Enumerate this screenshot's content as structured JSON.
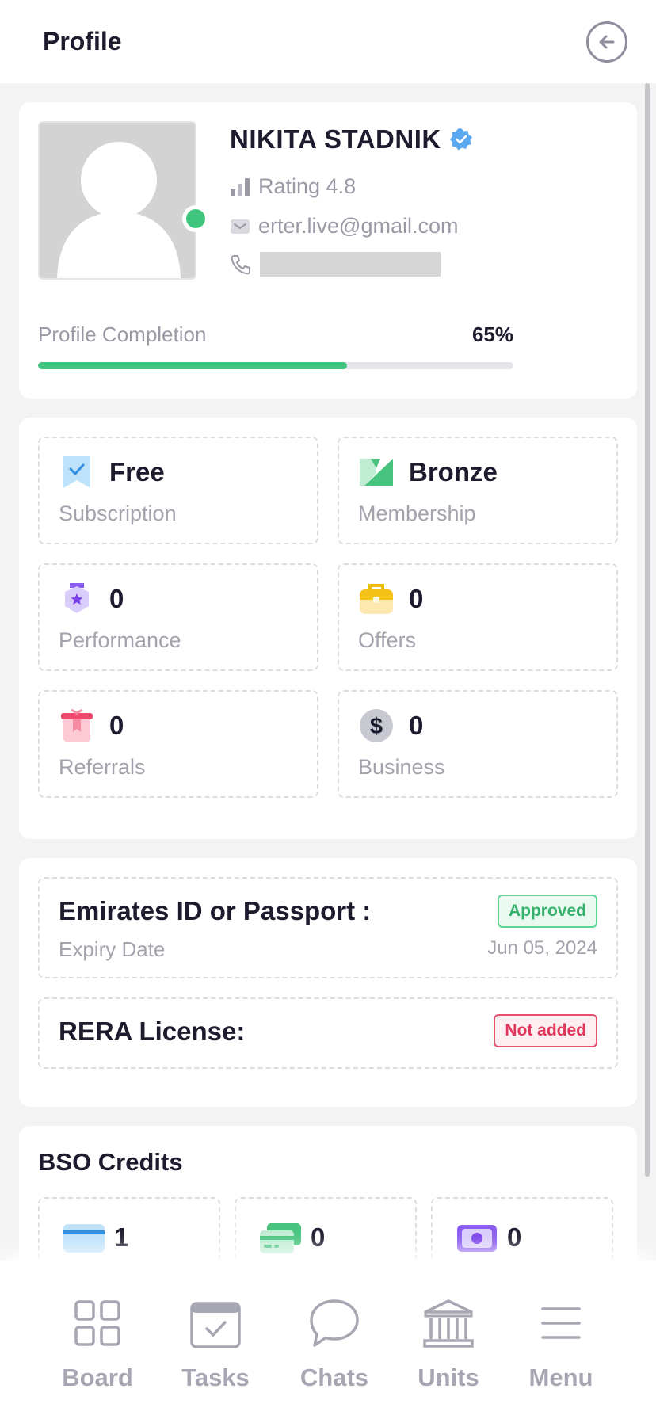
{
  "header": {
    "title": "Profile"
  },
  "profile": {
    "name": "NIKITA STADNIK",
    "rating": "Rating 4.8",
    "email": "erter.live@gmail.com",
    "completion_label": "Profile Completion",
    "completion_pct_text": "65%",
    "completion_value": 0.65
  },
  "stats": [
    {
      "value": "Free",
      "label": "Subscription",
      "icon": "bookmark-check-icon"
    },
    {
      "value": "Bronze",
      "label": "Membership",
      "icon": "medal-ribbon-icon"
    },
    {
      "value": "0",
      "label": "Performance",
      "icon": "badge-star-icon"
    },
    {
      "value": "0",
      "label": "Offers",
      "icon": "briefcase-icon"
    },
    {
      "value": "0",
      "label": "Referrals",
      "icon": "gift-icon"
    },
    {
      "value": "0",
      "label": "Business",
      "icon": "dollar-coin-icon"
    }
  ],
  "documents": {
    "id": {
      "title": "Emirates ID or Passport :",
      "sub": "Expiry Date",
      "date": "Jun 05, 2024",
      "status": "Approved"
    },
    "rera": {
      "title": "RERA License:",
      "status": "Not added"
    }
  },
  "credits": {
    "title": "BSO Credits",
    "items": [
      {
        "value": "1",
        "icon": "card-icon"
      },
      {
        "value": "0",
        "icon": "cards-icon"
      },
      {
        "value": "0",
        "icon": "cash-icon"
      }
    ]
  },
  "nav": [
    {
      "label": "Board",
      "icon": "grid-icon"
    },
    {
      "label": "Tasks",
      "icon": "calendar-check-icon"
    },
    {
      "label": "Chats",
      "icon": "chat-bubble-icon"
    },
    {
      "label": "Units",
      "icon": "building-icon"
    },
    {
      "label": "Menu",
      "icon": "hamburger-icon"
    }
  ],
  "colors": {
    "accent_green": "#40c57e",
    "badge_red": "#e0385b",
    "text_dark": "#1c1c2e",
    "text_muted": "#a3a3ad"
  }
}
